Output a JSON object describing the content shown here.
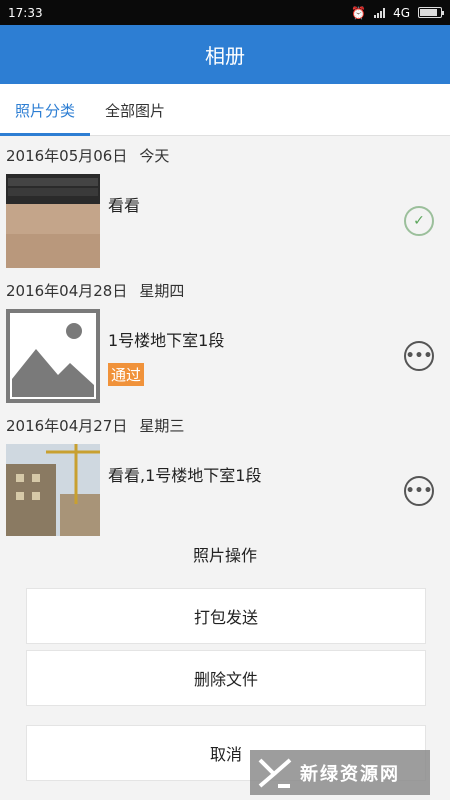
{
  "status_bar": {
    "time": "17:33",
    "network": "4G"
  },
  "app_bar": {
    "title": "相册"
  },
  "tabs": [
    {
      "label": "照片分类",
      "active": true
    },
    {
      "label": "全部图片",
      "active": false
    }
  ],
  "groups": [
    {
      "date": "2016年05月06日",
      "weekday": "今天",
      "items": [
        {
          "title": "看看",
          "badge": "",
          "action_icon": "check-circle-icon"
        }
      ]
    },
    {
      "date": "2016年04月28日",
      "weekday": "星期四",
      "items": [
        {
          "title": "1号楼地下室1段",
          "badge": "通过",
          "action_icon": "more-circle-icon"
        }
      ]
    },
    {
      "date": "2016年04月27日",
      "weekday": "星期三",
      "items": [
        {
          "title": "看看,1号楼地下室1段",
          "badge": "",
          "action_icon": "more-circle-icon"
        }
      ]
    }
  ],
  "action_sheet": {
    "title": "照片操作",
    "send": "打包发送",
    "delete": "删除文件",
    "cancel": "取消"
  },
  "watermark": {
    "text": "新绿资源网"
  },
  "colors": {
    "accent": "#2d7ed3",
    "badge": "#f0923a",
    "check": "#5aa55a"
  }
}
